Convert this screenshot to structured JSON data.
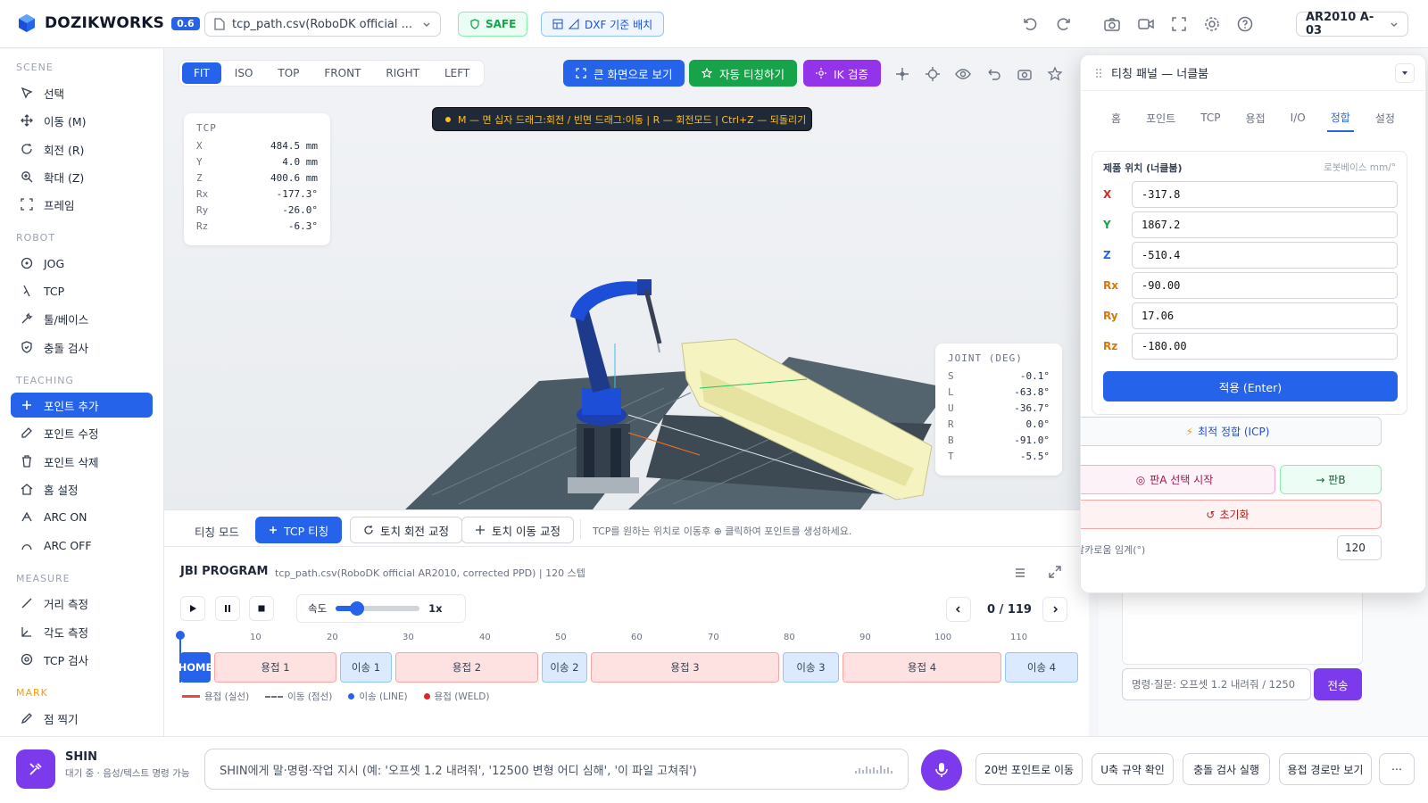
{
  "app": {
    "name": "DOZIKWORKS",
    "version": "0.6"
  },
  "topbar": {
    "file": "tcp_path.csv(RoboDK official ...",
    "safe": "SAFE",
    "dxf": "DXF 기준 배치",
    "model": "AR2010 A-03"
  },
  "sidebar": {
    "sections": {
      "scene": "SCENE",
      "robot": "ROBOT",
      "teaching": "TEACHING",
      "measure": "MEASURE",
      "mark": "MARK"
    },
    "scene": [
      "선택",
      "이동 (M)",
      "회전 (R)",
      "확대 (Z)",
      "프레임"
    ],
    "robot": [
      "JOG",
      "TCP",
      "툴/베이스",
      "충돌 검사"
    ],
    "teaching": [
      "포인트 추가",
      "포인트 수정",
      "포인트 삭제",
      "홈 설정",
      "ARC ON",
      "ARC OFF"
    ],
    "measure": [
      "거리 측정",
      "각도 측정",
      "TCP 검사"
    ],
    "mark": [
      "점 찍기"
    ]
  },
  "viewport": {
    "views": [
      "FIT",
      "ISO",
      "TOP",
      "FRONT",
      "RIGHT",
      "LEFT"
    ],
    "active_view": "FIT",
    "btn_fullscreen": "큰 화면으로 보기",
    "btn_autoteach": "자동 티칭하기",
    "btn_ik": "IK 검증",
    "hint": "M — 면 십자 드래그:회전 / 빈면 드래그:이동 | R — 회전모드 | Ctrl+Z — 되돌리기",
    "tcp": {
      "title": "TCP",
      "rows": [
        {
          "k": "X",
          "v": "484.5 mm"
        },
        {
          "k": "Y",
          "v": "4.0 mm"
        },
        {
          "k": "Z",
          "v": "400.6 mm"
        },
        {
          "k": "Rx",
          "v": "-177.3°"
        },
        {
          "k": "Ry",
          "v": "-26.0°"
        },
        {
          "k": "Rz",
          "v": "-6.3°"
        }
      ]
    },
    "joint": {
      "title": "JOINT (DEG)",
      "rows": [
        {
          "k": "S",
          "v": "-0.1°"
        },
        {
          "k": "L",
          "v": "-63.8°"
        },
        {
          "k": "U",
          "v": "-36.7°"
        },
        {
          "k": "R",
          "v": "0.0°"
        },
        {
          "k": "B",
          "v": "-91.0°"
        },
        {
          "k": "T",
          "v": "-5.5°"
        }
      ]
    }
  },
  "teachbar": {
    "mode_label": "티칭 모드",
    "tcp_teach": "TCP 티칭",
    "rot_fix": "토치 회전 교정",
    "move_fix": "토치 이동 교정",
    "hint": "TCP를 원하는 위치로 이동후 ⊕ 클릭하여 포인트를 생성하세요."
  },
  "program": {
    "title": "JBI PROGRAM",
    "subtitle": "tcp_path.csv(RoboDK official AR2010, corrected PPD) | 120 스텝",
    "speed_label": "속도",
    "speed_value": "1x",
    "speed_fraction": 0.25,
    "step": "0 / 119",
    "ticks": [
      "10",
      "20",
      "30",
      "40",
      "50",
      "60",
      "70",
      "80",
      "90",
      "100",
      "110"
    ],
    "segments": [
      {
        "label": "HOME",
        "kind": "home"
      },
      {
        "label": "용접 1",
        "kind": "weld"
      },
      {
        "label": "이송 1",
        "kind": "move"
      },
      {
        "label": "용접 2",
        "kind": "weld"
      },
      {
        "label": "이송 2",
        "kind": "move"
      },
      {
        "label": "용접 3",
        "kind": "weld"
      },
      {
        "label": "이송 3",
        "kind": "move"
      },
      {
        "label": "용접 4",
        "kind": "weld"
      },
      {
        "label": "이송 4",
        "kind": "move"
      }
    ],
    "legend": [
      "용접 (실선)",
      "이동 (점선)",
      "이송 (LINE)",
      "용접 (WELD)"
    ]
  },
  "tpanel": {
    "title": "티칭 패널 — 너클붐",
    "tabs": [
      "홈",
      "포인트",
      "TCP",
      "용접",
      "I/O",
      "정합",
      "설정"
    ],
    "active_tab": "정합",
    "pos_title": "제품 위치 (너클붐)",
    "pos_unit": "로봇베이스 mm/°",
    "fields": [
      {
        "label": "X",
        "value": "-317.8",
        "color": "#dc2626"
      },
      {
        "label": "Y",
        "value": "1867.2",
        "color": "#16a34a"
      },
      {
        "label": "Z",
        "value": "-510.4",
        "color": "#2563eb"
      },
      {
        "label": "Rx",
        "value": "-90.00",
        "color": "#d97706"
      },
      {
        "label": "Ry",
        "value": "17.06",
        "color": "#d97706"
      },
      {
        "label": "Rz",
        "value": "-180.00",
        "color": "#d97706"
      }
    ],
    "apply": "적용 (Enter)",
    "icp": "최적 정합 (ICP)",
    "pick_a": "판A 선택 시작",
    "pick_b": "→ 판B",
    "reset": "초기화",
    "sharp_label": "날카로움 임계(°)",
    "sharp_value": "120"
  },
  "chat": {
    "placeholder": "명령·질문: 오프셋 1.2 내려줘 / 1250",
    "send": "전송"
  },
  "bottom": {
    "name": "SHIN",
    "status": "대기 중 · 음성/텍스트 명령 가능",
    "cmd_placeholder": "SHIN에게 말·명령·작업 지시 (예: '오프셋 1.2 내려줘', '12500 변형 어디 심해', '이 파일 고쳐줘')",
    "quick": [
      "20번 포인트로 이동",
      "U축 규약 확인",
      "충돌 검사 실행",
      "용접 경로만 보기"
    ]
  }
}
